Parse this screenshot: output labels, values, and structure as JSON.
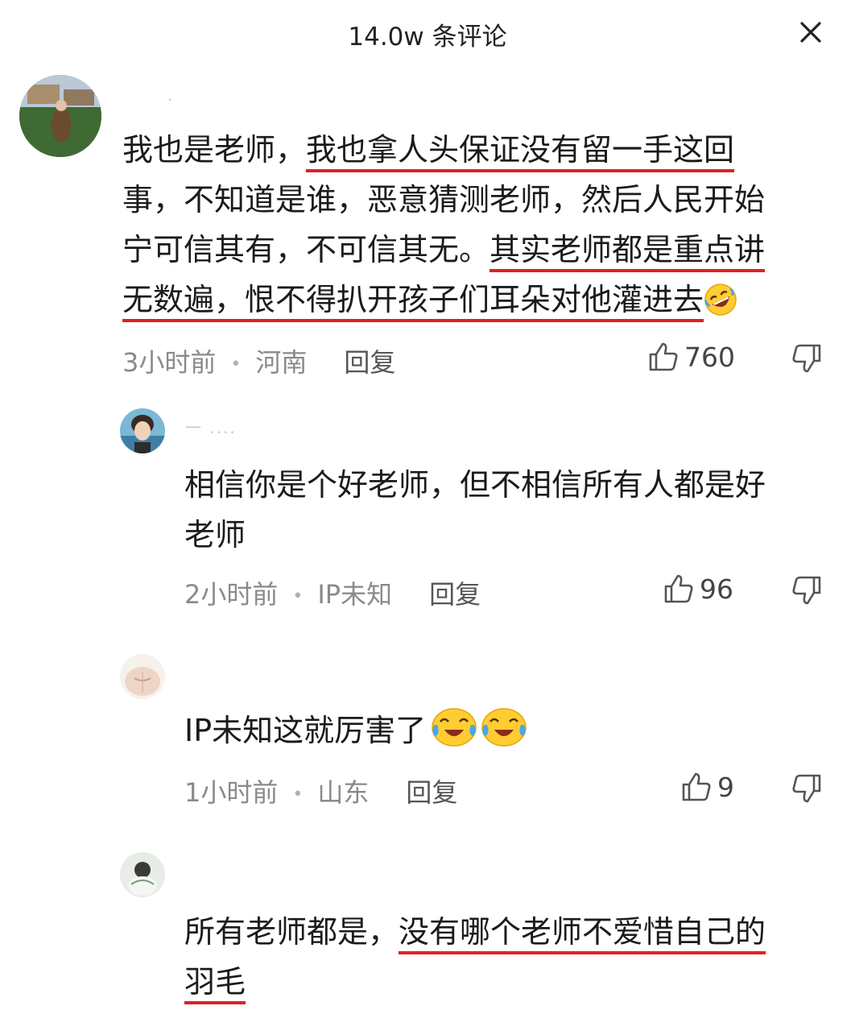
{
  "header": {
    "title": "14.0w 条评论"
  },
  "comments": [
    {
      "username": "·",
      "lines": [
        {
          "plain": "我也是老师，",
          "ul": "我也拿人头保证没有留一手这回",
          "after": ""
        },
        {
          "plain": "事，不知道是谁，恶意猜测老师，然后人民开始",
          "ul": "",
          "after": ""
        },
        {
          "plain": "宁可信其有，不可信其无。",
          "ul": "其实老师都是重点讲",
          "after": ""
        },
        {
          "plain": "",
          "ul": "无数遍，恨不得扒开孩子们耳朵对他灌进去",
          "after": ""
        }
      ],
      "time": "3小时前",
      "location": "河南",
      "reply": "回复",
      "likes": "760"
    },
    {
      "username": "一  ....",
      "lines": [
        {
          "plain": "相信你是个好老师，但不相信所有人都是好",
          "ul": "",
          "after": ""
        },
        {
          "plain": "老师",
          "ul": "",
          "after": ""
        }
      ],
      "time": "2小时前",
      "location": "IP未知",
      "reply": "回复",
      "likes": "96"
    },
    {
      "username": "",
      "lines": [
        {
          "plain": "IP未知这就厉害了",
          "ul": "",
          "after": ""
        }
      ],
      "time": "1小时前",
      "location": "山东",
      "reply": "回复",
      "likes": "9"
    },
    {
      "username": "",
      "lines": [
        {
          "plain": "所有老师都是，",
          "ul": "没有哪个老师不爱惜自己的",
          "after": ""
        },
        {
          "plain": "",
          "ul": "羽毛",
          "after": ""
        }
      ]
    }
  ],
  "icons": {
    "close": "close-icon",
    "like": "thumbs-up-icon",
    "dislike": "thumbs-down-icon",
    "laugh_emoji": "rolling-laugh-emoji",
    "cry_emoji": "tears-of-joy-emoji"
  },
  "colors": {
    "underline": "#e02020",
    "meta": "#8a8a8a"
  }
}
